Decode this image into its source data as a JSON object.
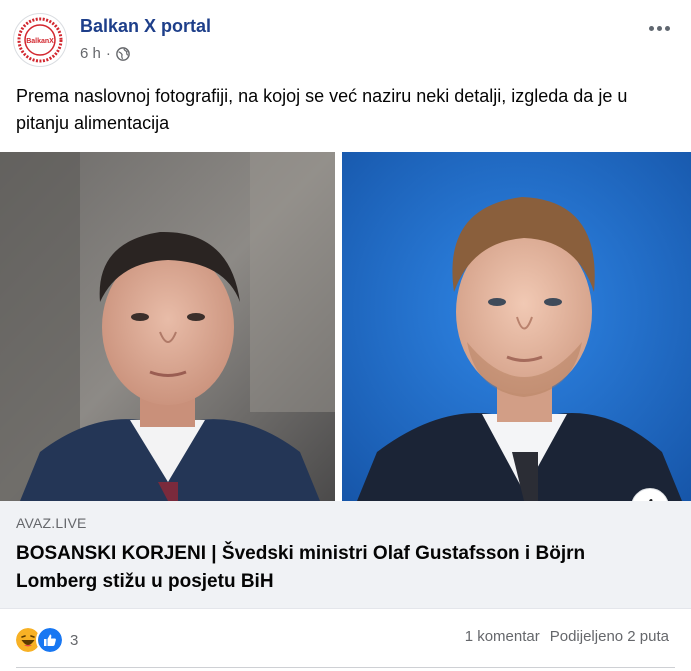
{
  "post": {
    "page_name": "Balkan X portal",
    "time": "6 h",
    "separator": "·",
    "caption": "Prema naslovnoj fotografiji, na kojoj se već naziru neki detalji, izgleda da je u pitanju alimentacija",
    "avatar_text": "BalkanX"
  },
  "link": {
    "domain": "AVAZ.LIVE",
    "headline": "BOSANSKI KORJENI | Švedski ministri Olaf Gustafsson i Böjrn Lomberg stižu u posjetu BiH",
    "info_label": "i"
  },
  "footer": {
    "reaction_count": "3",
    "comments": "1 komentar",
    "shares": "Podijeljeno 2 puta",
    "reactions": [
      "haha-icon",
      "like-icon"
    ]
  },
  "colors": {
    "page_name": "#1e3f8a",
    "link_bg": "#f0f2f5",
    "like_blue": "#1877f2",
    "haha_yellow": "#f7b125",
    "right_photo_bg": "#1f6fd1"
  }
}
